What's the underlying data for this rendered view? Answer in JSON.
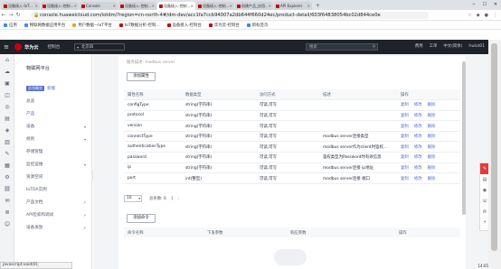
{
  "browser": {
    "tabs": [
      {
        "title": "设备接入-IoT...",
        "color": "#c7000b",
        "active": false
      },
      {
        "title": "设备接入-控制...",
        "color": "#c7000b",
        "active": false
      },
      {
        "title": "Console",
        "color": "#c7000b",
        "active": false
      },
      {
        "title": "设备接入-控制...",
        "color": "#c7000b",
        "active": false
      },
      {
        "title": "设备接入-控制...",
        "color": "#c7000b",
        "active": true
      },
      {
        "title": "设备接入-控制...",
        "color": "#c7000b",
        "active": false
      },
      {
        "title": "创建产品_应用...",
        "color": "#c7000b",
        "active": false
      },
      {
        "title": "API Explorer",
        "color": "#c7000b",
        "active": false
      }
    ],
    "new_tab_label": "+",
    "url": "console.huaweicloud.com/iotdm/?region=cn-north-4#/dm-dev/acc1fa7ccb94007a2db644f660d24ec/product-detail/603f64838054bc02d844ce0e",
    "bookmarks": [
      {
        "label": "应用",
        "color": "#4285f4"
      },
      {
        "label": "物联网数据应用平台",
        "color": "#4285f4"
      },
      {
        "label": "用户数据—IoT平台",
        "color": "#e8a33d"
      },
      {
        "label": "IoT数据分析-控制...",
        "color": "#c7000b"
      },
      {
        "label": "设备接入-控制台",
        "color": "#c7000b"
      },
      {
        "label": "华为云-控制台",
        "color": "#c7000b"
      },
      {
        "label": "新标签页",
        "color": "#4285f4"
      }
    ],
    "status_text": "javascript:void(0);"
  },
  "header": {
    "brand": "华为云",
    "console_label": "控制台",
    "region": "北京四",
    "search_placeholder": "搜索",
    "right_items": [
      "费用",
      "工单",
      "中文(简体)",
      "hwiot01"
    ]
  },
  "sidebar": {
    "title": "物联网平台",
    "items": [
      {
        "label": "新版",
        "badge": "总览概览",
        "active": true
      },
      {
        "label": "总览",
        "arrow": ""
      },
      {
        "label": "产品",
        "arrow": "",
        "active": true
      },
      {
        "label": "设备",
        "arrow": "▾"
      },
      {
        "label": "规则",
        "arrow": "▾"
      },
      {
        "label": "存储管理",
        "arrow": ""
      },
      {
        "label": "监控运维",
        "arrow": "▾"
      },
      {
        "label": "资源空间",
        "arrow": ""
      },
      {
        "label": "IoTDA实例",
        "arrow": ""
      },
      {
        "label": "产品文档",
        "arrow": "↗"
      },
      {
        "label": "API检索和调试",
        "arrow": "↗"
      },
      {
        "label": "设备发放",
        "arrow": "↗"
      }
    ]
  },
  "main": {
    "faded_text": "服务描述: modbus server",
    "add_property_button": "添加属性",
    "property_table": {
      "headers": [
        "属性名称",
        "数据类型",
        "访问方式",
        "描述",
        "操作"
      ],
      "rows": [
        [
          "configType",
          "string(字符串)",
          "可读,可写",
          "",
          ""
        ],
        [
          "protocol",
          "string(字符串)",
          "可读,可写",
          "",
          ""
        ],
        [
          "version",
          "string(字符串)",
          "可读,可写",
          "",
          ""
        ],
        [
          "connectType",
          "string(字符串)",
          "可读,可写",
          "modbus server连接类型",
          ""
        ],
        [
          "authenticationType",
          "string(字符串)",
          "可读,可写",
          "modbus server作为client时鉴权...",
          ""
        ],
        [
          "password",
          "string(字符串)",
          "可读,可写",
          "鉴权类型为Password时有效信息",
          ""
        ],
        [
          "ip",
          "string(字符串)",
          "可读,可写",
          "modbus server连接 ip地址",
          ""
        ],
        [
          "port",
          "int(整型)",
          "可读,可写",
          "modbus server连接 端口",
          ""
        ]
      ],
      "actions": [
        "复制",
        "修改",
        "删除"
      ]
    },
    "pager": {
      "page_size": "10",
      "total_label": "总条数: 8",
      "current_page": "1"
    },
    "add_command_button": "添加命令",
    "command_table": {
      "headers": [
        "命令名称",
        "下发参数",
        "响应参数",
        "操作"
      ]
    }
  },
  "taskbar": {
    "time": "14:05"
  }
}
